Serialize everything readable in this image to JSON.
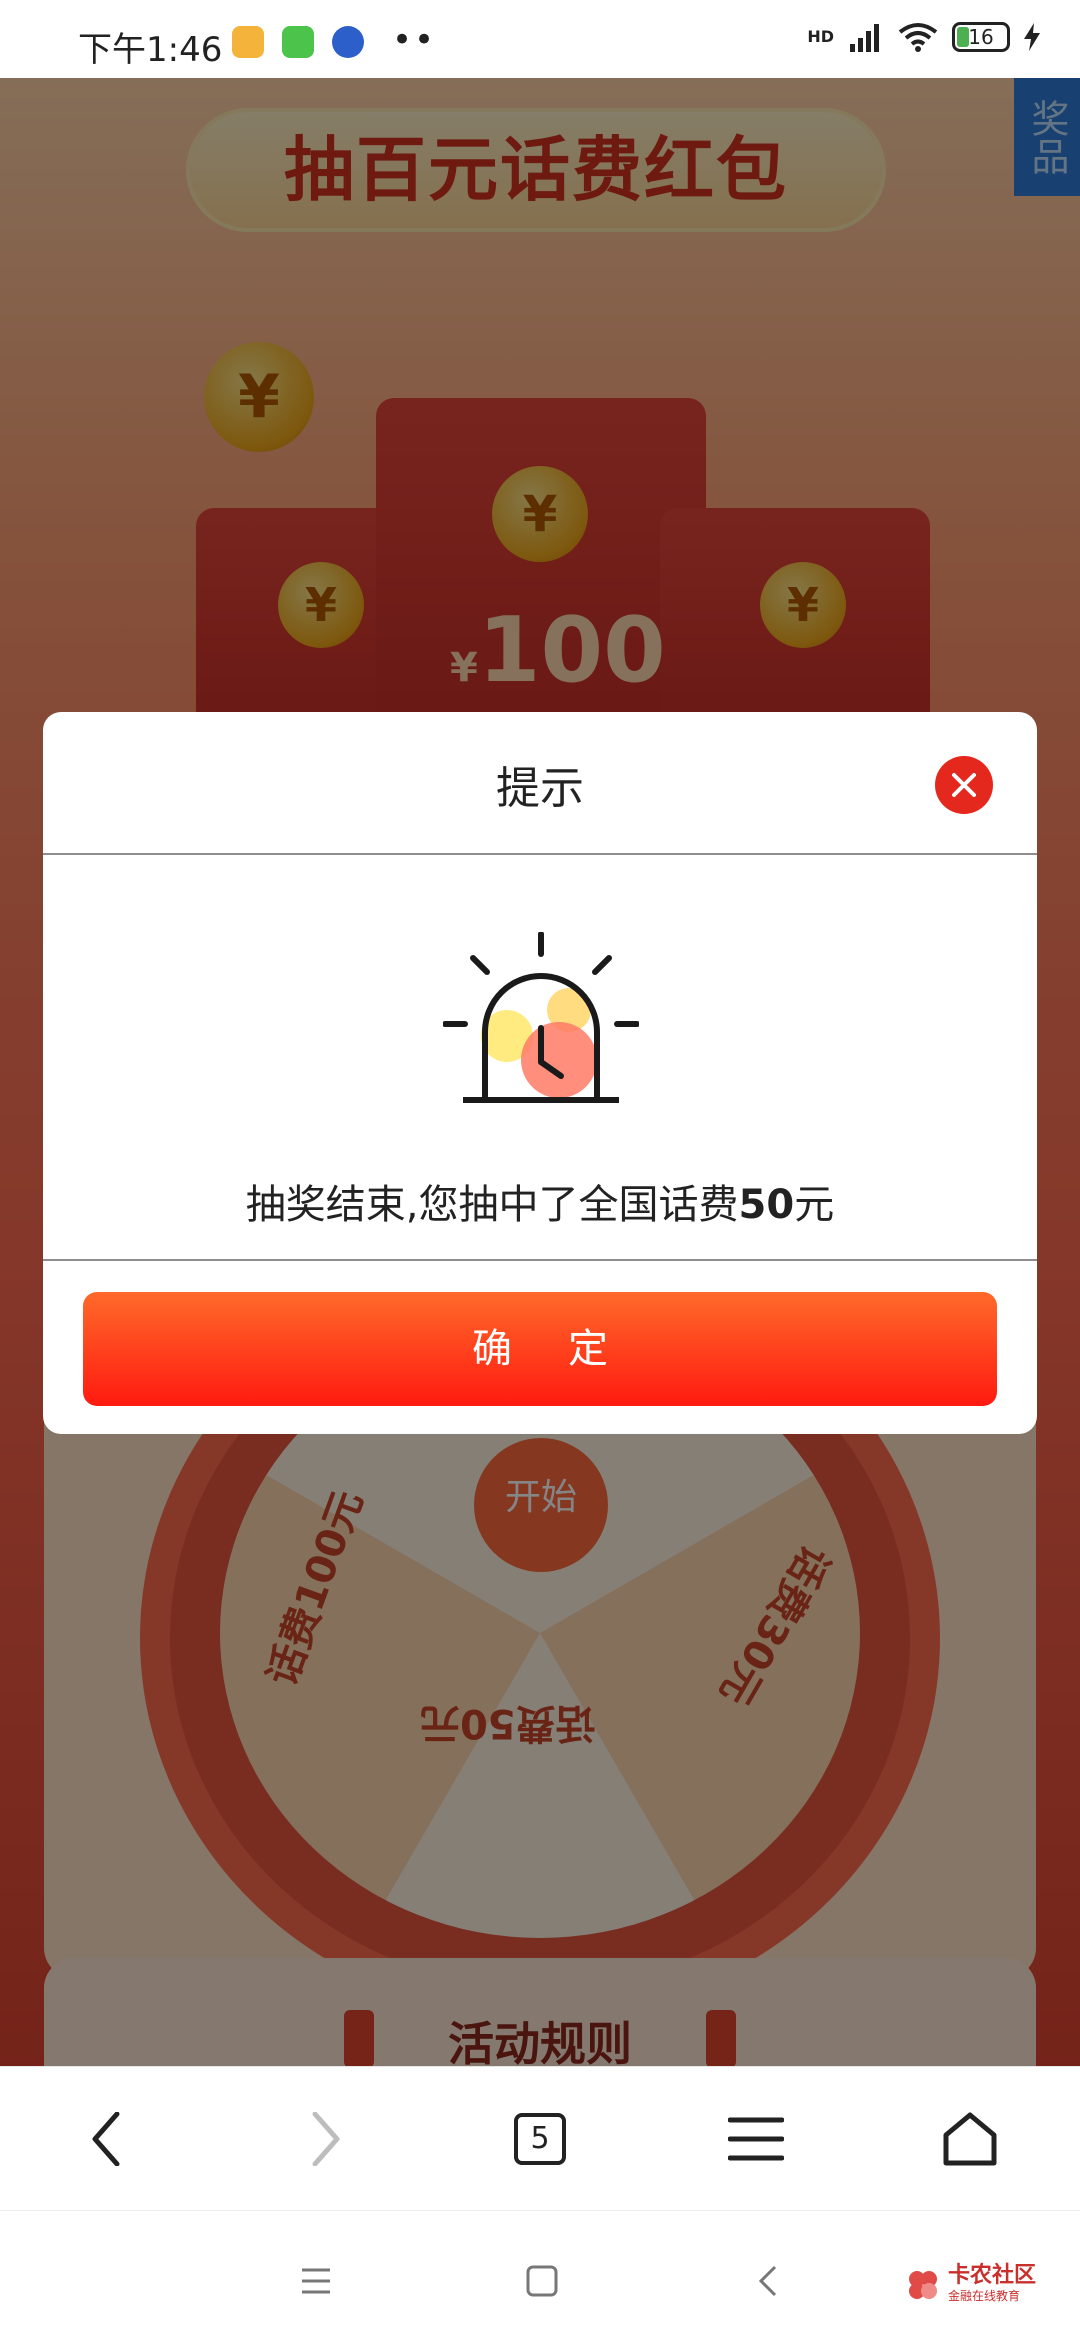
{
  "status_bar": {
    "time": "下午1:46",
    "network": "HD",
    "battery": "16"
  },
  "page": {
    "banner_title": "抽百元话费红包",
    "prize_tab": "奖品",
    "envelope_amount": "100",
    "currency": "¥",
    "wheel": {
      "start_label": "开始",
      "segments": [
        "话费100元",
        "话费50元",
        "话费30元"
      ]
    },
    "rules_title": "活动规则"
  },
  "modal": {
    "title": "提示",
    "message_prefix": "抽奖结束,您抽中了全国话费",
    "message_amount": "50",
    "message_suffix": "元",
    "confirm_label": "确定"
  },
  "browser_toolbar": {
    "tab_count": "5"
  },
  "watermark": {
    "name": "卡农社区",
    "subtitle": "金融在线教育"
  },
  "colors": {
    "accent_red": "#e5281e",
    "button_top": "#ff6a2a",
    "button_bottom": "#ff1a10"
  }
}
